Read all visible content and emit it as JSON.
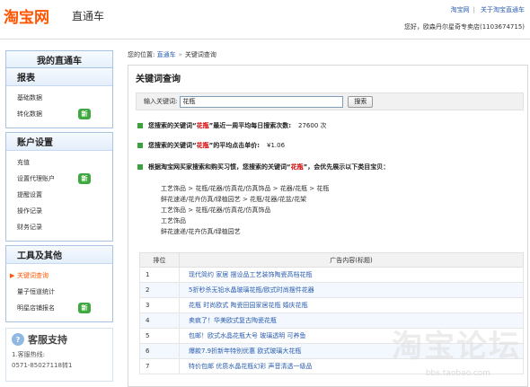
{
  "header": {
    "logo": "淘宝网",
    "product": "直通车",
    "links": [
      "淘宝网",
      "关于淘宝直通车"
    ],
    "greeting": "您好，欧森丹尔星奇专卖店(1103674715)"
  },
  "sidebar": {
    "title": "我的直通车",
    "sections": [
      {
        "title": "报表",
        "items": [
          {
            "label": "基础数据"
          },
          {
            "label": "转化数据",
            "badge": "新"
          }
        ]
      },
      {
        "title": "账户设置",
        "items": [
          {
            "label": "充值"
          },
          {
            "label": "设置代理账户",
            "badge": "新"
          },
          {
            "label": "提醒设置"
          },
          {
            "label": "操作记录"
          },
          {
            "label": "财务记录"
          }
        ]
      },
      {
        "title": "工具及其他",
        "items": [
          {
            "label": "关键词查询",
            "active": true
          },
          {
            "label": "量子恒道统计"
          },
          {
            "label": "明星店铺报名",
            "badge": "新"
          }
        ]
      }
    ],
    "support": {
      "title": "客服支持",
      "line1": "1.客服热线:",
      "line2": "0571-85027118转1"
    }
  },
  "breadcrumb": {
    "prefix": "您的位置:",
    "link": "直通车",
    "sep": "»",
    "current": "关键词查询"
  },
  "main": {
    "title": "关键词查询",
    "search": {
      "label": "输入关键词:",
      "value": "花瓶",
      "button": "搜索"
    },
    "keyword": "花瓶",
    "results": {
      "line1_pre": "您搜索的关键词“",
      "line1_post": "”最近一周平均每日搜索次数:",
      "line1_value": "27600 次",
      "line2_pre": "您搜索的关键词“",
      "line2_post": "”的平均点击单价:",
      "line2_value": "¥1.06",
      "line3_pre": "根据淘宝网买家搜索和购买习惯，您搜索的关键词“",
      "line3_post": "”，会优先展示以下类目宝贝："
    },
    "categories": [
      "工艺饰品 > 花瓶/花器/仿真花/仿真饰品 > 花器/花瓶 > 花瓶",
      "鲜花速递/花卉仿真/绿植园艺 > 花瓶/花器/花盆/花架",
      "工艺饰品 > 花瓶/花器/仿真花/仿真饰品",
      "工艺饰品",
      "鲜花速递/花卉仿真/绿植园艺"
    ],
    "table": {
      "headers": [
        "排位",
        "广告内容(标题)"
      ],
      "rows": [
        {
          "rank": "1",
          "title": "现代简约 家居 摆设品工艺装饰陶瓷高档花瓶"
        },
        {
          "rank": "2",
          "title": "5折秒杀无铅水晶玻璃花瓶/欧式时尚摆件花器"
        },
        {
          "rank": "3",
          "title": "花瓶 时尚欧式 陶瓷田园家居花瓶 婚庆花瓶"
        },
        {
          "rank": "4",
          "title": "卖疯了！华美欧式复古陶瓷花瓶"
        },
        {
          "rank": "5",
          "title": "包邮！欧式水晶花瓶大号 玻璃透明 可养鱼"
        },
        {
          "rank": "6",
          "title": "爆款7.9折新年特别优惠 欧式玻璃大花瓶"
        },
        {
          "rank": "7",
          "title": "特价包邮 优质水晶花瓶幻彩 声音清透一级品"
        }
      ]
    }
  },
  "watermark": {
    "text": "淘宝论坛",
    "url": "bbs.taobao.com"
  }
}
